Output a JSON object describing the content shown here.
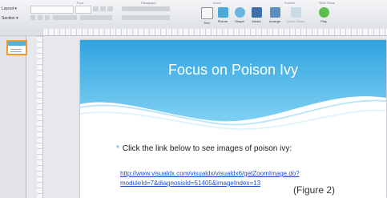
{
  "ribbon": {
    "groups": {
      "font": "Font",
      "paragraph": "Paragraph",
      "insert": "Insert",
      "format": "Format",
      "slide_show": "Slide Show"
    },
    "left_items": [
      "Layout ▾",
      "Section ▾"
    ],
    "buttons": [
      "Text",
      "Picture",
      "Shape",
      "Media",
      "Arrange",
      "Quick Styles",
      "Play"
    ]
  },
  "slide": {
    "title": "Focus on Poison Ivy",
    "bullet": "Click the link below to see images of poison ivy:",
    "link_line1": "http://www.visualdx.com/visualdx/visualdx6/getZoomImage.do?",
    "link_line2": "moduleId=7&diagnosisId=51405&imageIndex=13",
    "caption": "(Figure 2)"
  },
  "colors": {
    "title_band": "#45b3e6",
    "accent": "#3aa7e3",
    "link": "#1f4fd0",
    "selection": "#f19a2b"
  }
}
